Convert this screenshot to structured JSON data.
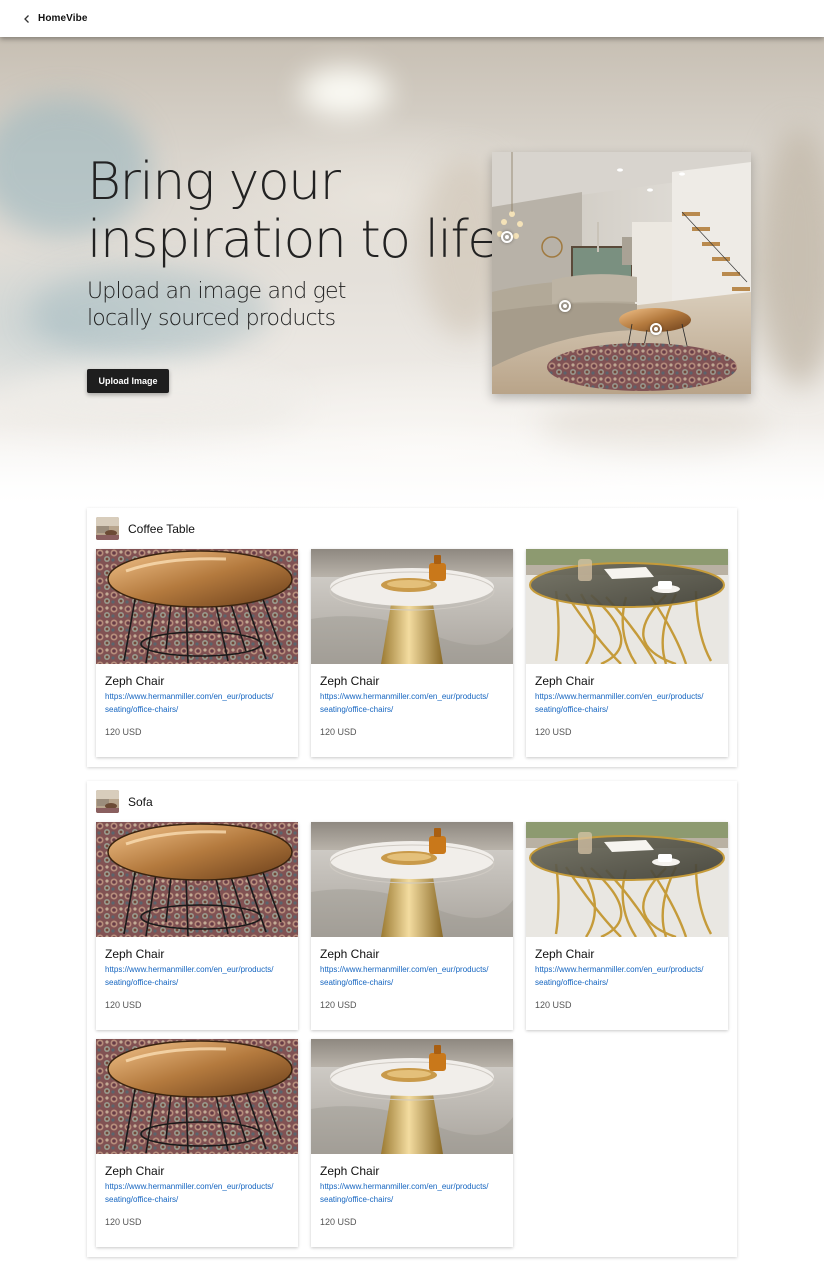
{
  "header": {
    "back_icon": "chevron-left-icon",
    "brand": "HomeVibe"
  },
  "hero": {
    "title_line1": "Bring your",
    "title_line2": "inspiration to life",
    "subtitle_line1": "Upload an image and get",
    "subtitle_line2": "locally sourced products",
    "upload_button": "Upload Image"
  },
  "sections": [
    {
      "title": "Coffee Table",
      "products": [
        {
          "name": "Zeph Chair",
          "url_line1": "https://www.hermanmiller.com/en_eur/products/",
          "url_line2": "seating/office-chairs/",
          "price": "120 USD"
        },
        {
          "name": "Zeph Chair",
          "url_line1": "https://www.hermanmiller.com/en_eur/products/",
          "url_line2": "seating/office-chairs/",
          "price": "120 USD"
        },
        {
          "name": "Zeph Chair",
          "url_line1": "https://www.hermanmiller.com/en_eur/products/",
          "url_line2": "seating/office-chairs/",
          "price": "120 USD"
        }
      ]
    },
    {
      "title": "Sofa",
      "products": [
        {
          "name": "Zeph Chair",
          "url_line1": "https://www.hermanmiller.com/en_eur/products/",
          "url_line2": "seating/office-chairs/",
          "price": "120 USD"
        },
        {
          "name": "Zeph Chair",
          "url_line1": "https://www.hermanmiller.com/en_eur/products/",
          "url_line2": "seating/office-chairs/",
          "price": "120 USD"
        },
        {
          "name": "Zeph Chair",
          "url_line1": "https://www.hermanmiller.com/en_eur/products/",
          "url_line2": "seating/office-chairs/",
          "price": "120 USD"
        },
        {
          "name": "Zeph Chair",
          "url_line1": "https://www.hermanmiller.com/en_eur/products/",
          "url_line2": "seating/office-chairs/",
          "price": "120 USD"
        },
        {
          "name": "Zeph Chair",
          "url_line1": "https://www.hermanmiller.com/en_eur/products/",
          "url_line2": "seating/office-chairs/",
          "price": "120 USD"
        }
      ]
    }
  ],
  "colors": {
    "button_bg": "#1e1e1e",
    "link": "#1565c0",
    "price": "#555555"
  }
}
